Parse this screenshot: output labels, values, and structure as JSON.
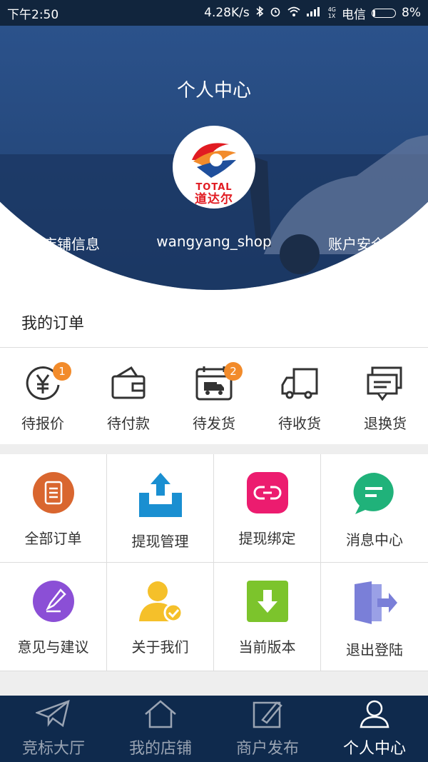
{
  "status_bar": {
    "time": "下午2:50",
    "speed": "4.28K/s",
    "carrier": "电信",
    "battery": "8%",
    "net_top": "4G",
    "net_bottom": "1X"
  },
  "header": {
    "title": "个人中心",
    "logo_text_en": "TOTAL",
    "logo_text_cn": "道达尔",
    "left_link": "店铺信息",
    "shop_name": "wangyang_shop",
    "right_link": "账户安全"
  },
  "orders": {
    "title": "我的订单",
    "items": [
      {
        "label": "待报价",
        "badge": "1",
        "icon": "yuan-clock-icon"
      },
      {
        "label": "待付款",
        "badge": "",
        "icon": "wallet-icon"
      },
      {
        "label": "待发货",
        "badge": "2",
        "icon": "calendar-truck-icon"
      },
      {
        "label": "待收货",
        "badge": "",
        "icon": "truck-icon"
      },
      {
        "label": "退换货",
        "badge": "",
        "icon": "return-message-icon"
      }
    ]
  },
  "menu": [
    {
      "label": "全部订单",
      "icon": "document-list-icon",
      "color": "#d9662f"
    },
    {
      "label": "提现管理",
      "icon": "upload-tray-icon",
      "color": "#1a8fd1"
    },
    {
      "label": "提现绑定",
      "icon": "link-icon",
      "color": "#ec1c6f"
    },
    {
      "label": "消息中心",
      "icon": "chat-bubble-icon",
      "color": "#20b27a"
    },
    {
      "label": "意见与建议",
      "icon": "pen-nib-icon",
      "color": "#8b4fd6"
    },
    {
      "label": "关于我们",
      "icon": "user-check-icon",
      "color": "#f5c02a"
    },
    {
      "label": "当前版本",
      "icon": "download-icon",
      "color": "#7cc42c"
    },
    {
      "label": "退出登陆",
      "icon": "logout-door-icon",
      "color": "#7a7fd8"
    }
  ],
  "tabbar": [
    {
      "label": "竞标大厅",
      "icon": "paper-plane-icon",
      "active": false
    },
    {
      "label": "我的店铺",
      "icon": "home-icon",
      "active": false
    },
    {
      "label": "商户发布",
      "icon": "edit-icon",
      "active": false
    },
    {
      "label": "个人中心",
      "icon": "person-icon",
      "active": true
    }
  ]
}
